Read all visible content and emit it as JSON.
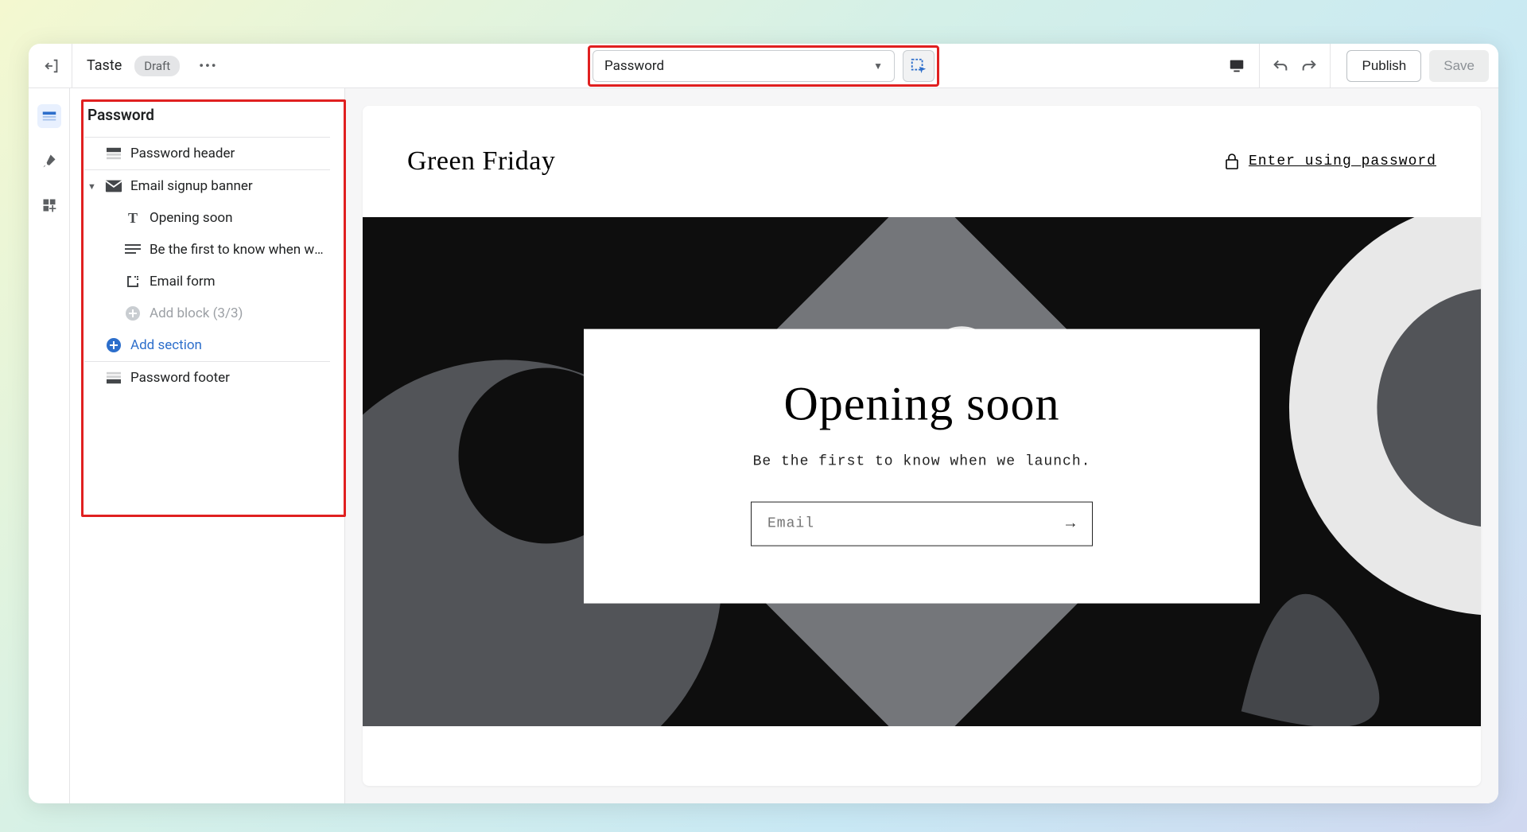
{
  "topbar": {
    "theme_name": "Taste",
    "status_badge": "Draft",
    "page_select_label": "Password",
    "publish_label": "Publish",
    "save_label": "Save"
  },
  "sidebar": {
    "title": "Password",
    "rows": {
      "password_header": "Password header",
      "email_signup_banner": "Email signup banner",
      "opening_soon": "Opening soon",
      "be_first": "Be the first to know when we…",
      "email_form": "Email form",
      "add_block": "Add block (3/3)",
      "add_section": "Add section",
      "password_footer": "Password footer"
    }
  },
  "preview": {
    "site_title": "Green Friday",
    "password_link": "Enter using password",
    "card_heading": "Opening soon",
    "card_paragraph": "Be the first to know when we launch.",
    "email_placeholder": "Email"
  }
}
